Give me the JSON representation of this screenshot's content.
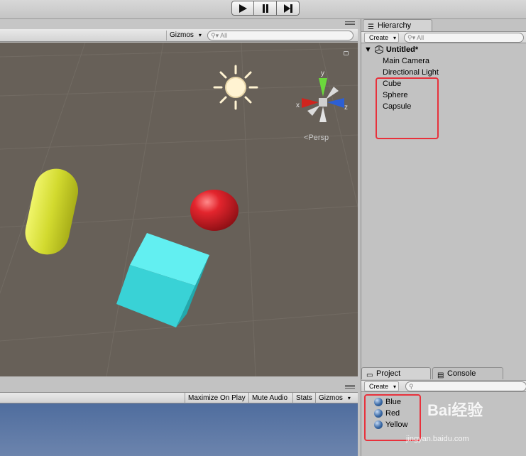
{
  "scene_toolbar": {
    "gizmos_label": "Gizmos",
    "search_placeholder": "All"
  },
  "scene_view": {
    "persp_label": "Persp",
    "axis_y": "y",
    "axis_x": "x",
    "axis_z": "z"
  },
  "hierarchy": {
    "tab_label": "Hierarchy",
    "create_label": "Create",
    "search_placeholder": "All",
    "scene_name": "Untitled*",
    "items": [
      {
        "label": "Main Camera"
      },
      {
        "label": "Directional Light"
      },
      {
        "label": "Cube"
      },
      {
        "label": "Sphere"
      },
      {
        "label": "Capsule"
      }
    ]
  },
  "game_toolbar": {
    "maximize_on_play": "Maximize On Play",
    "mute_audio": "Mute Audio",
    "stats": "Stats",
    "gizmos": "Gizmos"
  },
  "project": {
    "tab_label": "Project",
    "console_tab_label": "Console",
    "create_label": "Create",
    "materials": [
      {
        "label": "Blue"
      },
      {
        "label": "Red"
      },
      {
        "label": "Yellow"
      }
    ]
  },
  "colors": {
    "scene_background": "#676058",
    "highlight_box": "#e8313b",
    "cube": "#3dd4d8",
    "sphere": "#d8232b",
    "capsule": "#d4dc3c",
    "game_view": "#5a77a4"
  },
  "watermark": {
    "brand": "Bai经验",
    "url": "jingyan.baidu.com"
  }
}
